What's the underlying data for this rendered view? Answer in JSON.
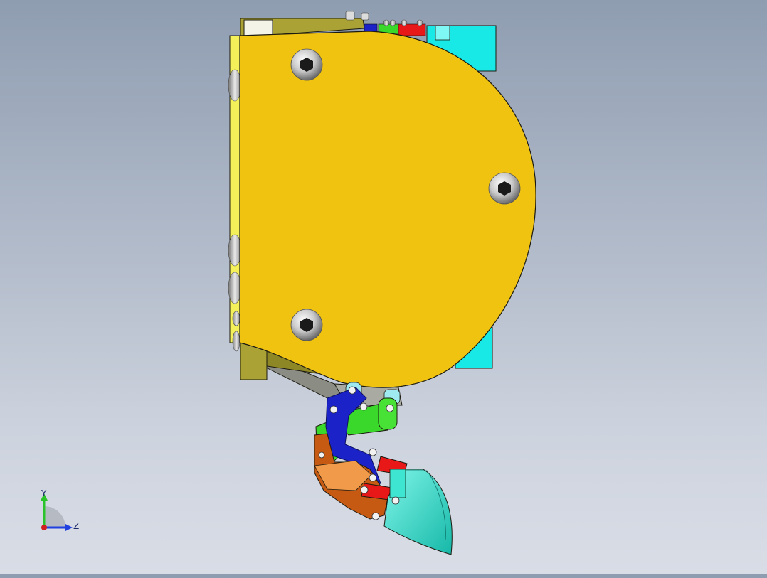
{
  "viewport": {
    "model": "gripper-assembly-side-view",
    "colors": {
      "housing": "#f1c311",
      "housing_edge": "#1c1a10",
      "mount_block": "#aaa235",
      "side_plate": "#f4f05a",
      "back_cyan": "#18e8e6",
      "link_blue": "#1b22c8",
      "link_green": "#3ad82a",
      "link_red": "#e81818",
      "plate_orange": "#c65a12",
      "finger_cyan": "#2fd8c4",
      "arm_gray": "#8b8d84"
    }
  },
  "triad": {
    "y_label": "Y",
    "z_label": "Z",
    "y_color": "#2ac42a",
    "z_color": "#2040e0",
    "x_color": "#d02020"
  }
}
